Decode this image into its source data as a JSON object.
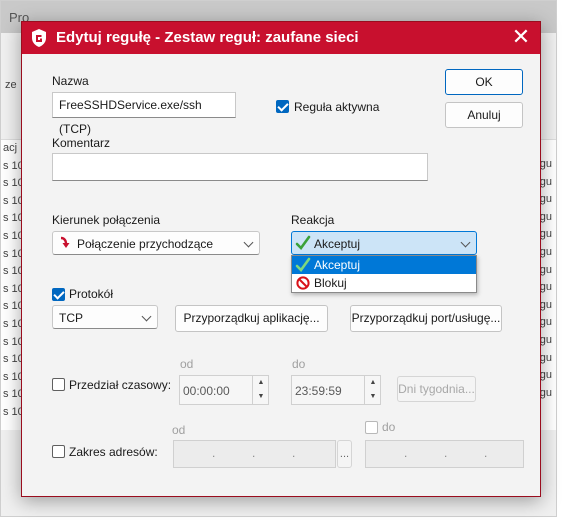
{
  "background": {
    "title_partial": "Pro",
    "left_text": "ze",
    "row_left": [
      "acj",
      "s 10",
      "s 10",
      "s 10",
      "s 10",
      "s 10",
      "s 10",
      "s 10",
      "s 10",
      "s 10",
      "s 10",
      "s 10",
      "s 10",
      "s 10",
      "s 10",
      "s 10"
    ],
    "row_right": [
      "egu",
      "egu",
      "egu",
      "egu",
      "egu",
      "egu",
      "egu",
      "egu",
      "egu",
      "egu",
      "egu",
      "egu",
      "egu",
      "egu"
    ]
  },
  "dialog": {
    "title": "Edytuj regułę - Zestaw reguł: zaufane sieci",
    "close_glyph": "✕",
    "name_label": "Nazwa",
    "name_value": "FreeSSHDService.exe/ssh (TCP)",
    "active_label": "Reguła aktywna",
    "ok_label": "OK",
    "cancel_label": "Anuluj",
    "comment_label": "Komentarz",
    "comment_value": "",
    "direction_label": "Kierunek połączenia",
    "direction_value": "Połączenie przychodzące",
    "reaction_label": "Reakcja",
    "reaction_value": "Akceptuj",
    "reaction_options": [
      "Akceptuj",
      "Blokuj"
    ],
    "protocol_label": "Protokół",
    "protocol_value": "TCP",
    "assign_app_label": "Przyporządkuj aplikację...",
    "assign_port_label": "Przyporządkuj port/usługę...",
    "time_from_label": "od",
    "time_to_label": "do",
    "time_range_label": "Przedział czasowy:",
    "time_from_value": "00:00:00",
    "time_to_value": "23:59:59",
    "weekdays_label": "Dni tygodnia...",
    "addr_from_label": "od",
    "addr_to_label": "do",
    "addr_range_label": "Zakres adresów:",
    "addr_browse_label": "...",
    "ip_dots": [
      ".",
      ".",
      "."
    ]
  },
  "colors": {
    "title_bar": "#c8102e",
    "accent": "#0067c0",
    "selection": "#0078d7",
    "accept_icon": "#3aa13a",
    "block_icon": "#d9121a"
  },
  "icons": {
    "app": "shield-icon",
    "close": "close-icon",
    "direction": "incoming-arrow-icon",
    "accept": "checkmark-icon",
    "block": "prohibited-icon"
  }
}
